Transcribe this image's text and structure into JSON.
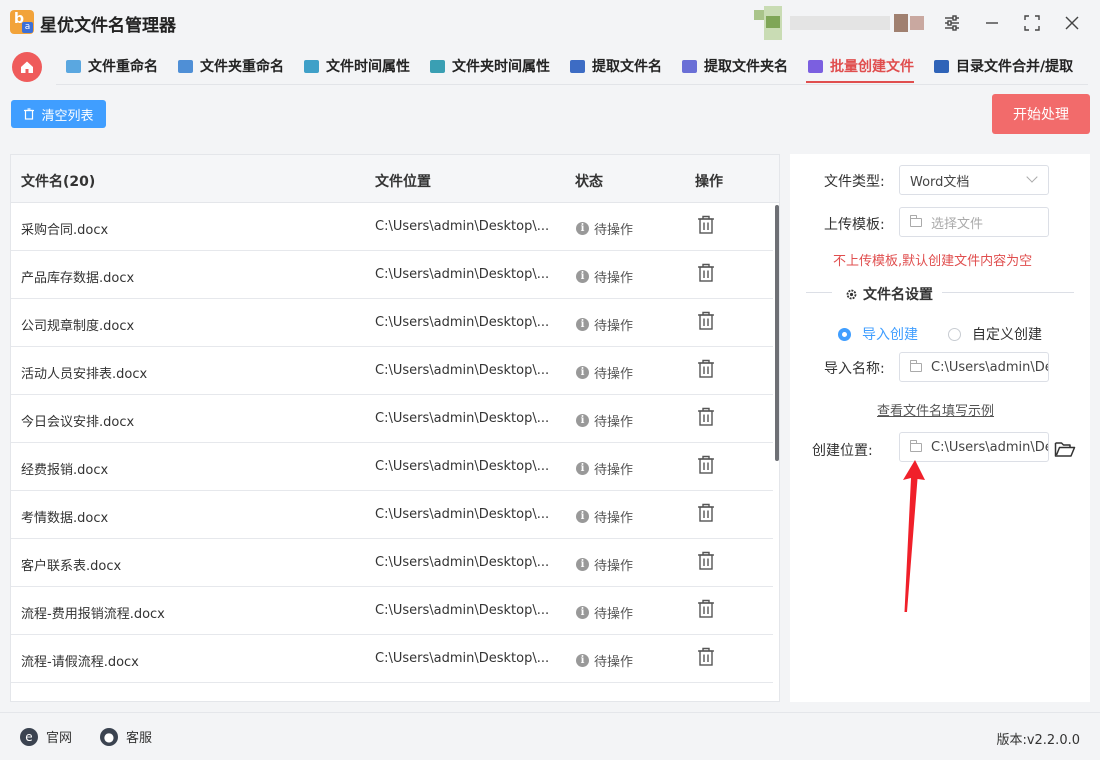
{
  "app": {
    "title": "星优文件名管理器"
  },
  "tabs": [
    {
      "label": "文件重命名",
      "icon": "file-rename-icon",
      "color": "#5aa7e0"
    },
    {
      "label": "文件夹重命名",
      "icon": "folder-rename-icon",
      "color": "#4f8fd6"
    },
    {
      "label": "文件时间属性",
      "icon": "file-time-icon",
      "color": "#3fa0c8"
    },
    {
      "label": "文件夹时间属性",
      "icon": "folder-time-icon",
      "color": "#3a9fb3"
    },
    {
      "label": "提取文件名",
      "icon": "extract-filename-icon",
      "color": "#3d6cc4"
    },
    {
      "label": "提取文件夹名",
      "icon": "extract-foldername-icon",
      "color": "#6a6fd6"
    },
    {
      "label": "批量创建文件",
      "icon": "batch-create-icon",
      "color": "#7b5fe0",
      "active": true
    },
    {
      "label": "目录文件合并/提取",
      "icon": "merge-extract-icon",
      "color": "#2f63b8"
    }
  ],
  "toolbar": {
    "clear_label": "清空列表",
    "start_label": "开始处理"
  },
  "table": {
    "headers": {
      "name": "文件名(20)",
      "location": "文件位置",
      "status": "状态",
      "action": "操作"
    },
    "rows": [
      {
        "name": "采购合同.docx",
        "location": "C:\\Users\\admin\\Desktop\\...",
        "status": "待操作"
      },
      {
        "name": "产品库存数据.docx",
        "location": "C:\\Users\\admin\\Desktop\\...",
        "status": "待操作"
      },
      {
        "name": "公司规章制度.docx",
        "location": "C:\\Users\\admin\\Desktop\\...",
        "status": "待操作"
      },
      {
        "name": "活动人员安排表.docx",
        "location": "C:\\Users\\admin\\Desktop\\...",
        "status": "待操作"
      },
      {
        "name": "今日会议安排.docx",
        "location": "C:\\Users\\admin\\Desktop\\...",
        "status": "待操作"
      },
      {
        "name": "经费报销.docx",
        "location": "C:\\Users\\admin\\Desktop\\...",
        "status": "待操作"
      },
      {
        "name": "考情数据.docx",
        "location": "C:\\Users\\admin\\Desktop\\...",
        "status": "待操作"
      },
      {
        "name": "客户联系表.docx",
        "location": "C:\\Users\\admin\\Desktop\\...",
        "status": "待操作"
      },
      {
        "name": "流程-费用报销流程.docx",
        "location": "C:\\Users\\admin\\Desktop\\...",
        "status": "待操作"
      },
      {
        "name": "流程-请假流程.docx",
        "location": "C:\\Users\\admin\\Desktop\\...",
        "status": "待操作"
      }
    ]
  },
  "settings": {
    "file_type_label": "文件类型:",
    "file_type_value": "Word文档",
    "template_label": "上传模板:",
    "template_placeholder": "选择文件",
    "warning": "不上传模板,默认创建文件内容为空",
    "section_title": "文件名设置",
    "radio_import": "导入创建",
    "radio_custom": "自定义创建",
    "import_name_label": "导入名称:",
    "import_name_value": "C:\\Users\\admin\\De",
    "example_link": "查看文件名填写示例",
    "location_label": "创建位置:",
    "location_value": "C:\\Users\\admin\\Des"
  },
  "footer": {
    "website": "官网",
    "support": "客服",
    "version": "版本:v2.2.0.0"
  },
  "colors": {
    "accent_red": "#e04e4e",
    "primary_blue": "#409eff",
    "start_button": "#f26b6b",
    "arrow": "#f0202a"
  }
}
